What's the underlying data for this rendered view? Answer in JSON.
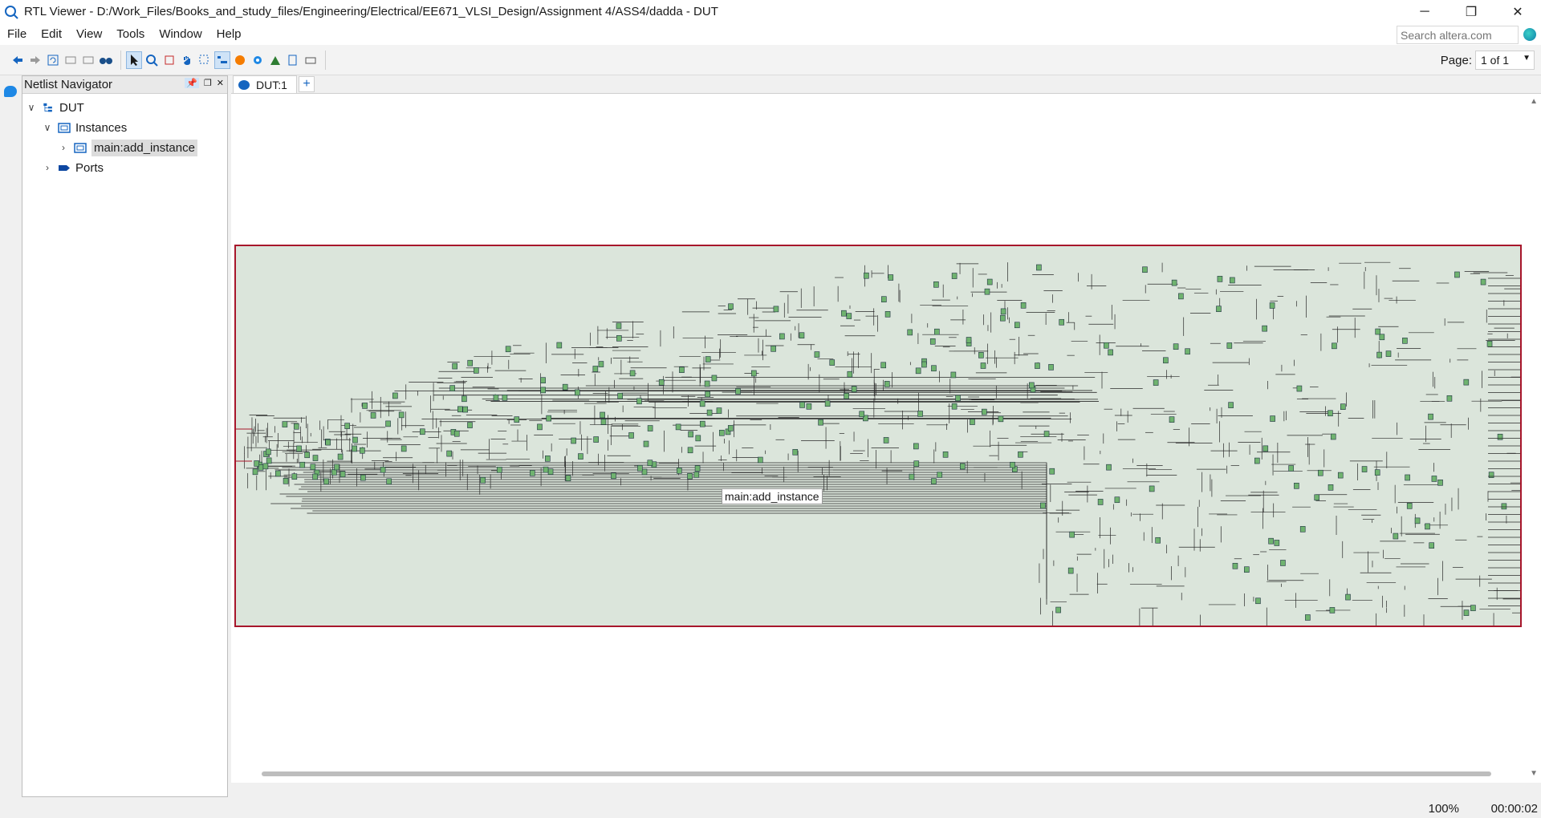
{
  "window": {
    "title": "RTL Viewer - D:/Work_Files/Books_and_study_files/Engineering/Electrical/EE671_VLSI_Design/Assignment 4/ASS4/dadda - DUT",
    "controls": {
      "minimize": "─",
      "restore": "❐",
      "close": "✕"
    }
  },
  "menubar": {
    "items": [
      "File",
      "Edit",
      "View",
      "Tools",
      "Window",
      "Help"
    ],
    "search_placeholder": "Search altera.com"
  },
  "toolbar": {
    "page_label": "Page:",
    "page_value": "1 of 1"
  },
  "navigator": {
    "title": "Netlist Navigator",
    "tree": [
      {
        "label": "DUT",
        "toggle": "∨",
        "icon": "hierarchy-icon"
      },
      {
        "label": "Instances",
        "toggle": "∨",
        "icon": "instance-icon"
      },
      {
        "label": "main:add_instance",
        "toggle": "›",
        "icon": "instance-icon",
        "selected": true
      },
      {
        "label": "Ports",
        "toggle": "›",
        "icon": "port-icon"
      }
    ]
  },
  "tabs": [
    {
      "label": "DUT:1"
    }
  ],
  "tab_add": "+",
  "schematic": {
    "instance_label": "main:add_instance"
  },
  "status": {
    "zoom": "100%",
    "elapsed": "00:00:02"
  },
  "colors": {
    "schematic_fill": "#dbe5db",
    "schematic_border": "#a7162b",
    "node_fill": "#6fb36f",
    "wire": "#2a2a2a"
  }
}
